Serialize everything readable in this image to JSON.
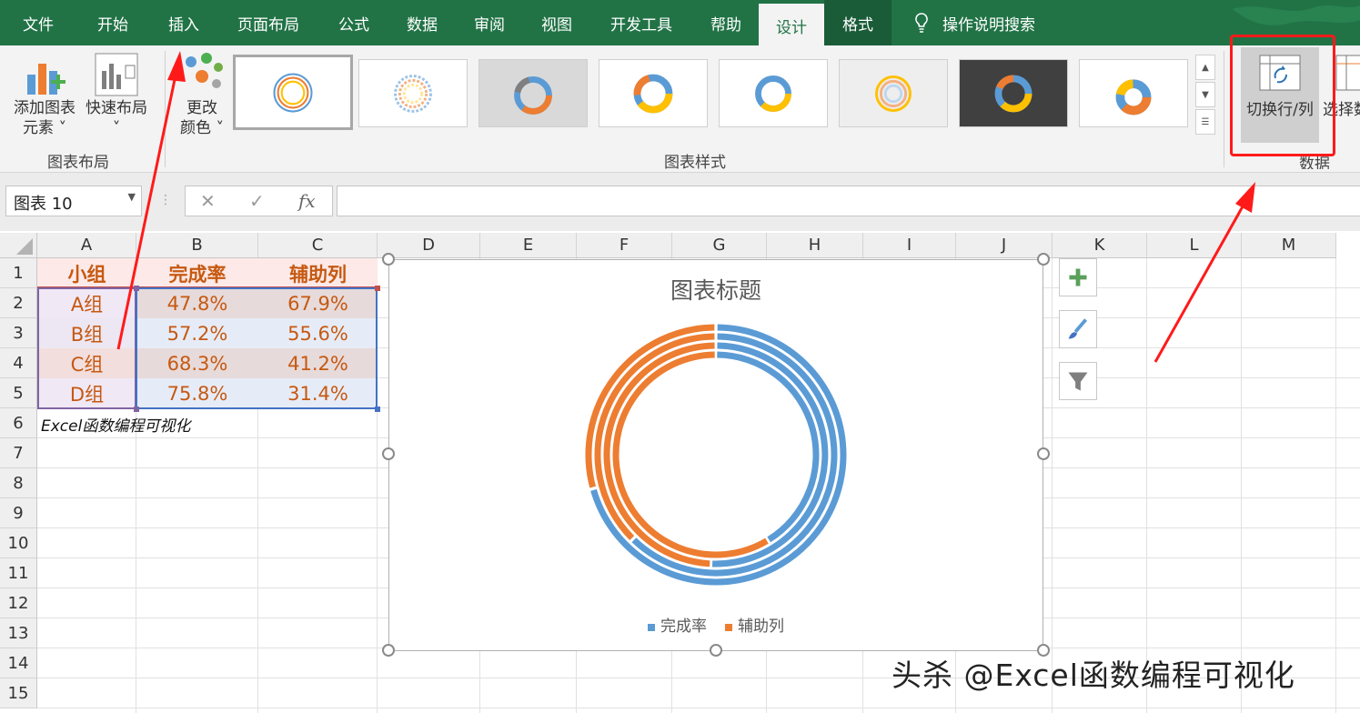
{
  "menu": {
    "tabs": [
      "文件",
      "开始",
      "插入",
      "页面布局",
      "公式",
      "数据",
      "审阅",
      "视图",
      "开发工具",
      "帮助",
      "设计",
      "格式"
    ],
    "active_tab": "设计",
    "search_label": "操作说明搜索"
  },
  "ribbon": {
    "add_element_label": "添加图表",
    "add_element_label2": "元素",
    "quick_layout_label": "快速布局",
    "change_color_label": "更改",
    "change_color_label2": "颜色",
    "group_layout": "图表布局",
    "group_styles": "图表样式",
    "switch_row_col": "切换行/列",
    "select_data": "选择数",
    "group_data": "数据"
  },
  "formula_bar": {
    "name_box": "图表 10",
    "fx_label": "fx",
    "formula": ""
  },
  "grid": {
    "columns": [
      "A",
      "B",
      "C",
      "D",
      "E",
      "F",
      "G",
      "H",
      "I",
      "J",
      "K",
      "L",
      "M"
    ],
    "rows": [
      "1",
      "2",
      "3",
      "4",
      "5",
      "6",
      "7",
      "8",
      "9",
      "10",
      "11",
      "12",
      "13",
      "14",
      "15"
    ],
    "table_header": [
      "小组",
      "完成率",
      "辅助列"
    ],
    "table_rows": [
      [
        "A组",
        "47.8%",
        "67.9%"
      ],
      [
        "B组",
        "57.2%",
        "55.6%"
      ],
      [
        "C组",
        "68.3%",
        "41.2%"
      ],
      [
        "D组",
        "75.8%",
        "31.4%"
      ]
    ],
    "note": "Excel函数编程可视化"
  },
  "colors": {
    "excel_green": "#217346",
    "series_blue": "#5b9bd5",
    "series_orange": "#ed7d31",
    "annotation_red": "#ff1a1a",
    "table_text": "#c65911"
  },
  "chart_data": {
    "type": "doughnut",
    "title": "图表标题",
    "series": [
      {
        "name": "完成率",
        "values": [
          0.478,
          0.572,
          0.683,
          0.758
        ]
      },
      {
        "name": "辅助列",
        "values": [
          0.679,
          0.556,
          0.412,
          0.314
        ]
      }
    ],
    "rings": [
      "A组",
      "B组",
      "C组",
      "D组"
    ],
    "legend": "bottom"
  },
  "watermark": "头杀 @Excel函数编程可视化"
}
